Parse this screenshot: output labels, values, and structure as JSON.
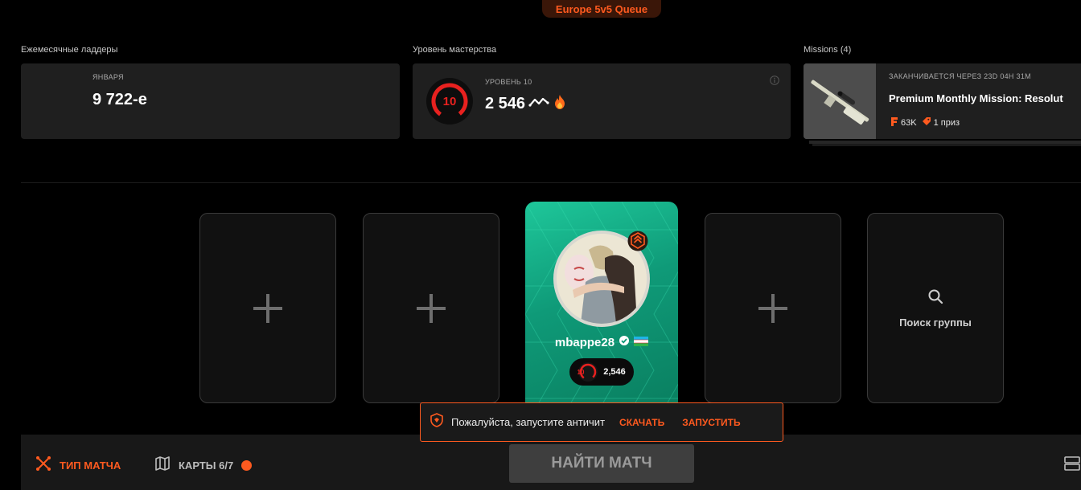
{
  "queue": {
    "label": "Europe 5v5 Queue"
  },
  "sections": {
    "ladders": {
      "label": "Ежемесячные ладдеры",
      "sub": "ЯНВАРЯ",
      "value": "9 722-е"
    },
    "mastery": {
      "label": "Уровень мастерства",
      "level_text": "УРОВЕНЬ 10",
      "level_number": "10",
      "elo": "2 546"
    },
    "missions": {
      "label": "Missions (4)",
      "ends_in": "ЗАКАНЧИВАЕТСЯ ЧЕРЕЗ 23D 04H 31M",
      "title": "Premium Monthly Mission: Resolut",
      "points": "63K",
      "prize": "1 приз"
    }
  },
  "party": {
    "player": {
      "name": "mbappe28",
      "level": "10",
      "elo": "2,546"
    },
    "search_slot_label": "Поиск группы"
  },
  "anticheat": {
    "message": "Пожалуйста, запустите античит",
    "download": "СКАЧАТЬ",
    "launch": "ЗАПУСТИТЬ"
  },
  "bottom": {
    "match_type": "ТИП МАТЧА",
    "maps": "КАРТЫ 6/7",
    "find_match": "НАЙТИ МАТЧ"
  },
  "colors": {
    "accent": "#ff5a1f",
    "card_green": "#14b489",
    "panel_bg": "#1f1f1f"
  },
  "icons": [
    "search-icon",
    "plus-icon",
    "shield-icon",
    "verified-icon",
    "flag-icon",
    "fire-icon",
    "map-icon",
    "crosshair-icon",
    "info-icon",
    "layout-icon"
  ]
}
